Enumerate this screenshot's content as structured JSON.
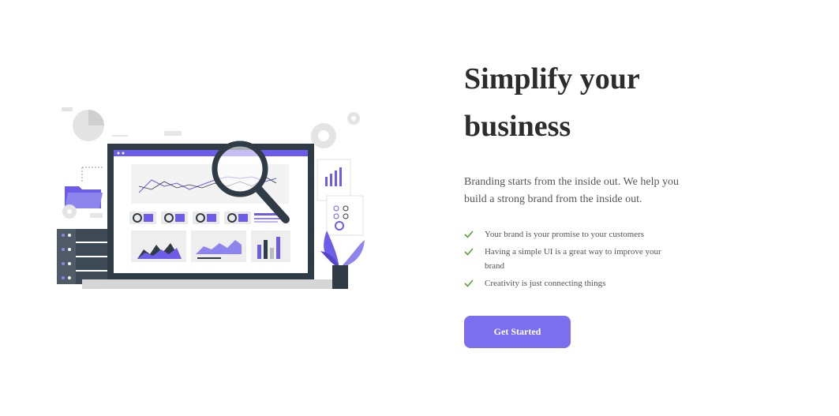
{
  "hero": {
    "title_line1": "Simplify your",
    "title_line2": "business",
    "subtitle": "Branding starts from the inside out. We help you build a strong brand from the inside out.",
    "features": [
      "Your brand is your promise to your customers",
      "Having a simple UI is a great way to improve your brand",
      "Creativity is just connecting things"
    ],
    "cta_label": "Get Started"
  },
  "illustration": {
    "name": "analytics-dashboard-illustration",
    "accent_color": "#6c5ce7",
    "check_color": "#5a9e3a"
  },
  "colors": {
    "title": "#2c2c2c",
    "text": "#555555",
    "button_bg": "#7b6ff0",
    "button_text": "#ffffff"
  }
}
